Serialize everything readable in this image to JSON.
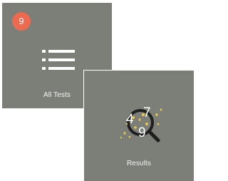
{
  "tiles": {
    "all_tests": {
      "label": "All Tests",
      "badge_count": "9",
      "badge_color": "#ec6a4f",
      "icon": "list-icon"
    },
    "results": {
      "label": "Results",
      "icon": "magnifier-numbers-icon",
      "icon_numbers": [
        "4",
        "7",
        "9"
      ]
    }
  },
  "colors": {
    "tile_background": "#7c7e78",
    "text": "#ffffff",
    "accent_yellow": "#e8c84a"
  }
}
